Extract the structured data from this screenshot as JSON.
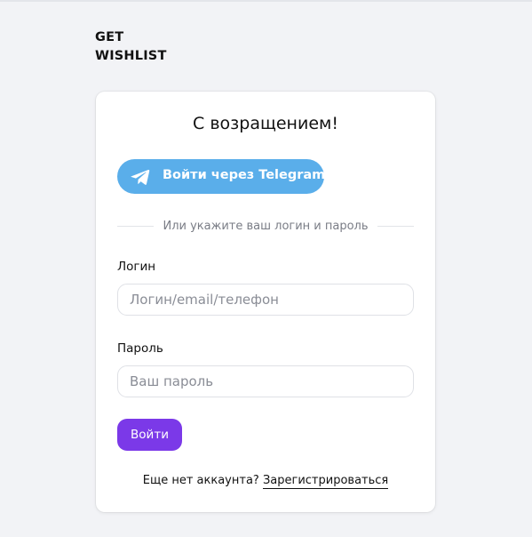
{
  "logo": {
    "line1": "GET",
    "line2": "WISHLIST"
  },
  "login_card": {
    "title": "С возращением!",
    "telegram_button": {
      "label": "Войти через Telegram",
      "icon": "telegram-plane-icon",
      "color": "#5aaeea"
    },
    "divider_text": "Или укажите ваш логин и пароль",
    "login_field": {
      "label": "Логин",
      "placeholder": "Логин/email/телефон",
      "value": ""
    },
    "password_field": {
      "label": "Пароль",
      "placeholder": "Ваш пароль",
      "value": ""
    },
    "submit_button": {
      "label": "Войти",
      "color": "#7b39e8"
    },
    "register": {
      "prompt": "Еще нет аккаунта?",
      "link_label": "Зарегистрироваться"
    }
  }
}
